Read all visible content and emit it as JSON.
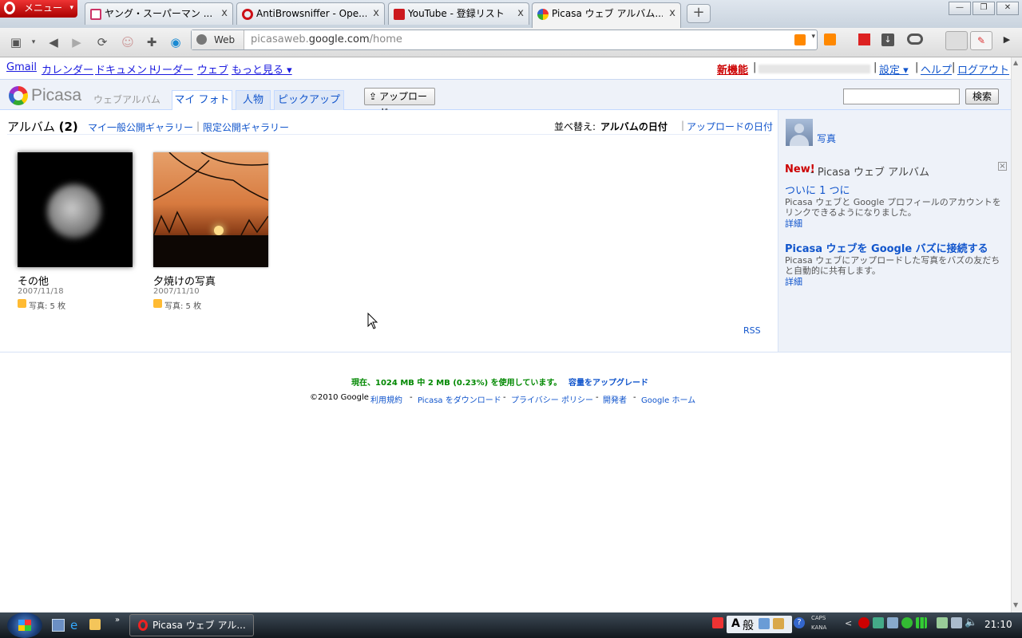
{
  "browser": {
    "menu_label": "メニュー",
    "tabs": [
      {
        "title": "ヤング・スーパーマン ...",
        "favicon_color": "#cc3366"
      },
      {
        "title": "AntiBrowsniffer - Ope...",
        "favicon_color": "#cc0f16"
      },
      {
        "title": "YouTube - 登録リスト",
        "favicon_color": "#cc181e"
      },
      {
        "title": "Picasa ウェブ アルバム...",
        "favicon_color": "#3a8f3a"
      }
    ],
    "search_engine_label": "Web",
    "url_prefix": "picasaweb.",
    "url_domain": "google.com",
    "url_path": "/home"
  },
  "gbar": {
    "links": [
      "Gmail",
      "カレンダー",
      "ドキュメント",
      "リーダー",
      "ウェブ",
      "もっと見る ▾"
    ],
    "new_features": "新機能",
    "settings": "設定 ▾",
    "help": "ヘルプ",
    "logout": "ログアウト"
  },
  "picasa": {
    "logo": "Picasa",
    "logo_sub": "ウェブアルバム",
    "tabs": [
      "マイ フォト",
      "人物",
      "ピックアップ"
    ],
    "upload_label": "アップロード",
    "search_label": "検索",
    "albums_heading": "アルバム",
    "albums_count": "(2)",
    "public_gallery": "マイ一般公開ギャラリー",
    "limited_gallery": "限定公開ギャラリー",
    "sort_label": "並べ替え:",
    "sort_album_date": "アルバムの日付",
    "sort_upload_date": "アップロードの日付",
    "albums": [
      {
        "title": "その他",
        "date": "2007/11/18",
        "count": "写真: 5 枚"
      },
      {
        "title": "夕焼けの写真",
        "date": "2007/11/10",
        "count": "写真: 5 枚"
      }
    ],
    "rss": "RSS"
  },
  "sidebar": {
    "photos_link": "写真",
    "new_label": "New!",
    "promo_title": " - Picasa ウェブ アルバム",
    "item1_title": "ついに 1 つに",
    "item1_text": "Picasa ウェブと Google プロフィールのアカウントをリンクできるようになりました。",
    "item1_more": "詳細",
    "item2_title": "Picasa ウェブを Google バズに接続する",
    "item2_text": "Picasa ウェブにアップロードした写真をバズの友だちと自動的に共有します。",
    "item2_more": "詳細"
  },
  "footer": {
    "storage": "現在、1024 MB 中 2 MB (0.23%) を使用しています。",
    "upgrade": "容量をアップグレード",
    "copyright": "©2010 Google",
    "terms": "利用規約",
    "download": "Picasa をダウンロード",
    "privacy": "プライバシー ポリシー",
    "developers": "開発者",
    "home": "Google ホーム"
  },
  "taskbar": {
    "window_title": "Picasa ウェブ アル...",
    "ime_mode": "A",
    "ime_label": "般",
    "caps": "CAPS",
    "kana": "KANA",
    "time": "21:10"
  }
}
